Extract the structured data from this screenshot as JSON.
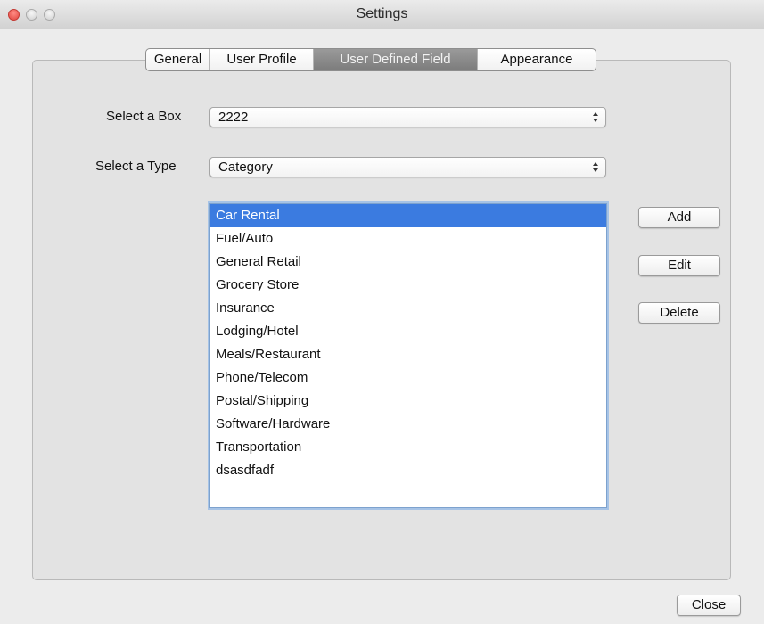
{
  "window": {
    "title": "Settings"
  },
  "tabs": [
    {
      "label": "General",
      "selected": false
    },
    {
      "label": "User Profile",
      "selected": false
    },
    {
      "label": "User Defined Field",
      "selected": true
    },
    {
      "label": "Appearance",
      "selected": false
    }
  ],
  "form": {
    "box_label": "Select a Box",
    "box_value": "2222",
    "type_label": "Select a Type",
    "type_value": "Category"
  },
  "list": {
    "selected_index": 0,
    "items": [
      "Car Rental",
      "Fuel/Auto",
      "General Retail",
      "Grocery Store",
      "Insurance",
      "Lodging/Hotel",
      "Meals/Restaurant",
      "Phone/Telecom",
      "Postal/Shipping",
      "Software/Hardware",
      "Transportation",
      "dsasdfadf"
    ]
  },
  "actions": {
    "add": "Add",
    "edit": "Edit",
    "delete": "Delete"
  },
  "footer": {
    "close": "Close"
  },
  "colors": {
    "selection": "#3b7be0",
    "close_light": "#e0443e"
  }
}
